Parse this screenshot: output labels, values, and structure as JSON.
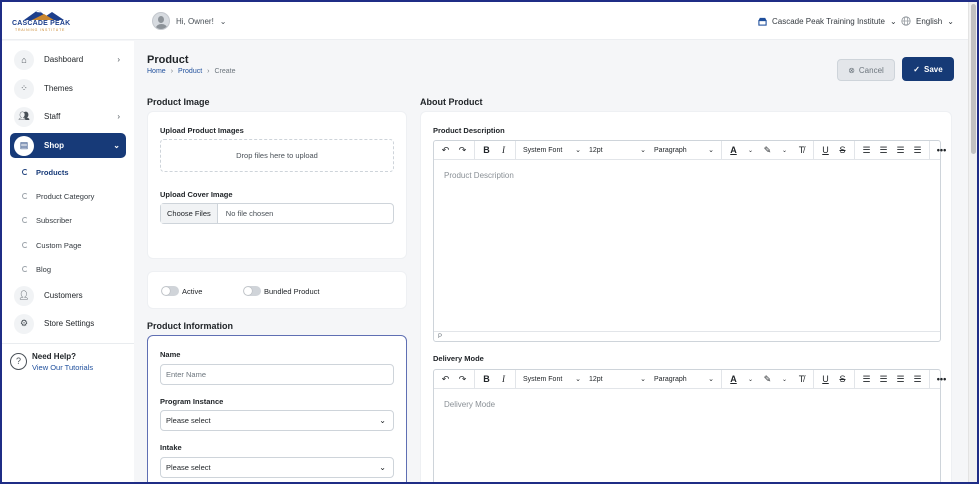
{
  "header": {
    "logo_text": "CASCADE PEAK",
    "logo_sub": "TRAINING INSTITUTE",
    "greeting": "Hi, Owner!",
    "institute": "Cascade Peak Training Institute",
    "language": "English"
  },
  "sidebar": {
    "items": [
      {
        "label": "Dashboard"
      },
      {
        "label": "Themes"
      },
      {
        "label": "Staff"
      },
      {
        "label": "Shop"
      },
      {
        "label": "Customers"
      },
      {
        "label": "Store Settings"
      }
    ],
    "shop_sub": [
      {
        "label": "Products"
      },
      {
        "label": "Product Category"
      },
      {
        "label": "Subscriber"
      },
      {
        "label": "Custom Page"
      },
      {
        "label": "Blog"
      }
    ],
    "help_title": "Need Help?",
    "help_link": "View Our Tutorials"
  },
  "page": {
    "title": "Product",
    "breadcrumb": [
      "Home",
      "Product",
      "Create"
    ],
    "cancel_label": "Cancel",
    "save_label": "Save"
  },
  "product_image": {
    "heading": "Product Image",
    "upload_label": "Upload Product Images",
    "drop_text": "Drop files here to upload",
    "cover_label": "Upload Cover Image",
    "choose_files": "Choose Files",
    "no_file": "No file chosen"
  },
  "toggles": {
    "active_label": "Active",
    "bundled_label": "Bundled Product"
  },
  "product_info": {
    "heading": "Product Information",
    "name_label": "Name",
    "name_placeholder": "Enter Name",
    "program_label": "Program Instance",
    "program_value": "Please select",
    "intake_label": "Intake",
    "intake_value": "Please select"
  },
  "about": {
    "heading": "About Product",
    "description_label": "Product Description",
    "description_placeholder": "Product Description",
    "delivery_label": "Delivery Mode",
    "delivery_placeholder": "Delivery Mode",
    "status_path": "P"
  },
  "editor_toolbar": {
    "font": "System Font",
    "size": "12pt",
    "block": "Paragraph"
  }
}
